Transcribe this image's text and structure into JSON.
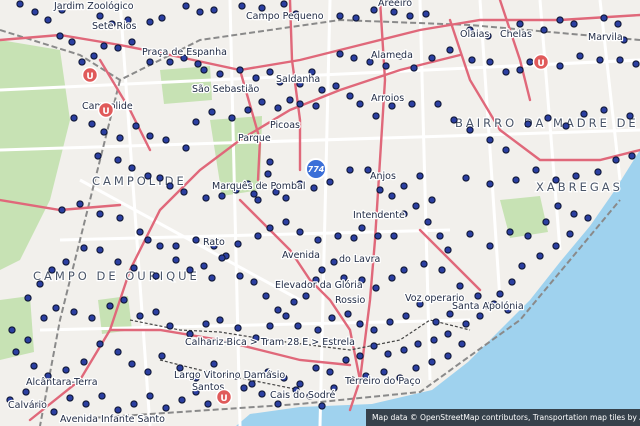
{
  "map": {
    "colors": {
      "land": "#f2f0ec",
      "water": "#9fd2ee",
      "park": "#c7e2b4",
      "road_major": "#e0687a",
      "road_minor": "#ffffff",
      "rail": "#8a8a8a",
      "stop": "#2b3fa1",
      "metro_badge": "#e05a5a",
      "route_badge": "#3b6fd8"
    },
    "place_labels": [
      "Jardim Zoológico",
      "Sete Rios",
      "Praça de Espanha",
      "Campo Pequeno",
      "Areeiro",
      "Olaias",
      "Chelas",
      "Marvila",
      "São Sebastião",
      "Alameda",
      "Saldanha",
      "Campolide",
      "Arroios",
      "Picoas",
      "Parque",
      "Marquês de Pombal",
      "Anjos",
      "Intendente",
      "Rato",
      "Avenida",
      "do Lavra",
      "Elevador da Glória",
      "Rossio",
      "Voz operario",
      "Santa Apolónia",
      "Calhariz-Bica > Tram 28 E > Estrela",
      "Largo Vitorino Damásio",
      "Santos",
      "Alcântara-Terra",
      "Calvário",
      "Avenida Infante Santo",
      "Terreiro do Paço",
      "Cais do Sodré"
    ],
    "district_labels": [
      "CAMPOLIDE",
      "CAMPO DE OURIQUE",
      "BAIRRO DA MADRE DE DEUS",
      "XABREGAS"
    ],
    "badges": {
      "metro_symbol": "U",
      "route_number": "774"
    },
    "attribution": {
      "prefix": "Map data ©",
      "link1": "OpenStreetMap contributors",
      "sep": ",",
      "link2": "Transportation map tiles by A"
    }
  }
}
